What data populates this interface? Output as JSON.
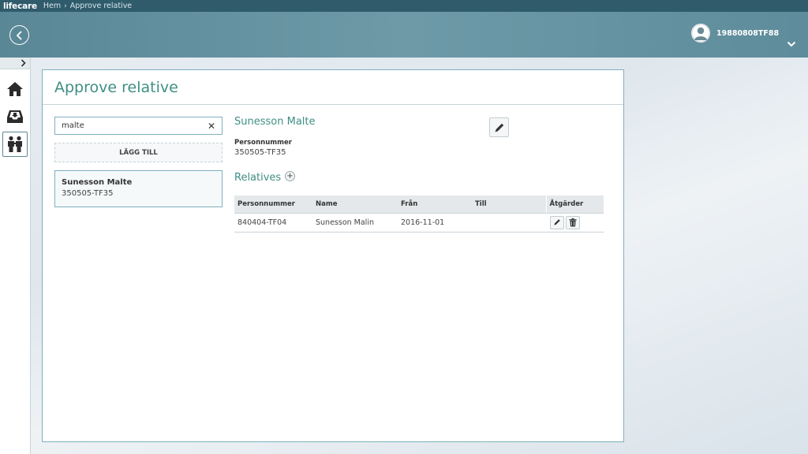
{
  "topbar": {
    "brand": "lifecare",
    "breadcrumbs": [
      "Hem",
      "Approve relative"
    ]
  },
  "header": {
    "user_name": "19880808TF88"
  },
  "sidebar": {
    "items": [
      {
        "name": "home",
        "icon": "home-icon"
      },
      {
        "name": "inbox",
        "icon": "inbox-icon"
      },
      {
        "name": "relatives",
        "icon": "family-icon",
        "active": true
      }
    ]
  },
  "page": {
    "title": "Approve relative"
  },
  "search": {
    "value": "malte"
  },
  "add_button": "LÄGG TILL",
  "result": {
    "name": "Sunesson Malte",
    "id": "350505-TF35"
  },
  "person": {
    "name": "Sunesson Malte",
    "pn_label": "Personnummer",
    "pn_value": "350505-TF35"
  },
  "relatives": {
    "title": "Relatives",
    "add_symbol": "+",
    "headers": {
      "pn": "Personnummer",
      "name": "Name",
      "from": "Från",
      "to": "Till",
      "actions": "Åtgärder"
    },
    "rows": [
      {
        "pn": "840404-TF04",
        "name": "Sunesson Malin",
        "from": "2016-11-01",
        "to": ""
      }
    ]
  },
  "colors": {
    "accent": "#3e8f84",
    "header": "#5a8796",
    "topbar": "#2f5b6b",
    "border": "#7fb0be"
  }
}
